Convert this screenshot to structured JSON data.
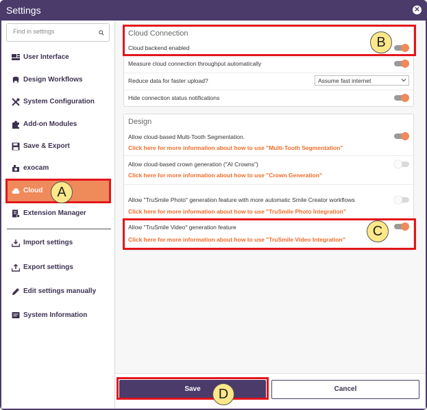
{
  "window": {
    "title": "Settings"
  },
  "search": {
    "placeholder": "Find in settings"
  },
  "sidebar": {
    "items": [
      {
        "label": "User Interface",
        "icon": "dashboard-icon"
      },
      {
        "label": "Design Workflows",
        "icon": "tooth-icon"
      },
      {
        "label": "System Configuration",
        "icon": "tools-icon"
      },
      {
        "label": "Add-on Modules",
        "icon": "puzzle-icon"
      },
      {
        "label": "Save & Export",
        "icon": "floppy-icon"
      },
      {
        "label": "exocam",
        "icon": "camera-icon"
      },
      {
        "label": "Cloud",
        "icon": "cloud-icon",
        "active": true
      },
      {
        "label": "Extension Manager",
        "icon": "extension-icon"
      }
    ],
    "actions": [
      {
        "label": "Import settings",
        "icon": "import-icon"
      },
      {
        "label": "Export settings",
        "icon": "export-icon"
      },
      {
        "label": "Edit settings manually",
        "icon": "pencil-icon"
      },
      {
        "label": "System Information",
        "icon": "info-icon"
      }
    ]
  },
  "cloud_connection": {
    "title": "Cloud Connection",
    "rows": [
      {
        "label": "Cloud backend enabled",
        "toggle": "on"
      },
      {
        "label": "Measure cloud connection throughput automatically",
        "toggle": "on"
      },
      {
        "label": "Reduce data for faster upload?",
        "select": "Assume fast internet"
      },
      {
        "label": "Hide connection status notifications",
        "toggle": "on"
      }
    ]
  },
  "design": {
    "title": "Design",
    "rows": [
      {
        "label": "Allow cloud-based Multi-Tooth Segmentation.",
        "link": "Click here for more information about how to use \"Multi-Tooth Segmentation\"",
        "toggle": "on"
      },
      {
        "label": "Allow cloud-based crown generation (\"AI Crowns\")",
        "link": "Click here for more information about how to use \"Crown Generation\"",
        "toggle": "off"
      },
      {
        "label": "Allow \"TruSmile Photo\" generation feature with more automatic Smile Creator workflows",
        "link": "Click here for more information about how to use \"TruSmile Photo Integration\"",
        "toggle": "off"
      },
      {
        "label": "Allow \"TruSmile Video\" generation feature",
        "link": "Click here for more information about how to use \"TruSmile Video Integration\"",
        "toggle": "on"
      }
    ]
  },
  "footer": {
    "save_label": "Save",
    "cancel_label": "Cancel"
  },
  "callouts": {
    "a": "A",
    "b": "B",
    "c": "C",
    "d": "D"
  },
  "colors": {
    "accent": "#ef8a5b",
    "primary": "#4a3b6b",
    "link": "#ef6c2a",
    "highlight": "#e3151b",
    "badge": "#ffe88a"
  }
}
